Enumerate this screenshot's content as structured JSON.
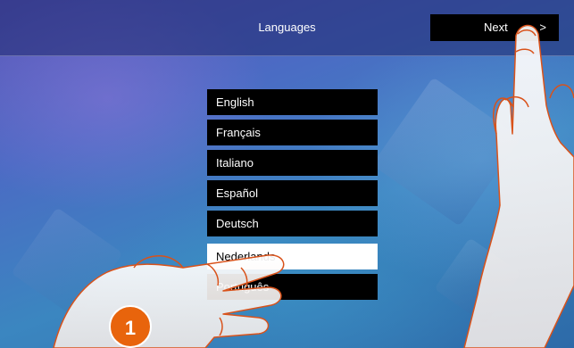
{
  "header": {
    "title": "Languages",
    "next_label": "Next",
    "next_arrow": ">"
  },
  "languages": [
    {
      "label": "English",
      "selected": false
    },
    {
      "label": "Français",
      "selected": false
    },
    {
      "label": "Italiano",
      "selected": false
    },
    {
      "label": "Español",
      "selected": false
    },
    {
      "label": "Deutsch",
      "selected": false
    },
    {
      "label": "Nederlands",
      "selected": true
    },
    {
      "label": "Português",
      "selected": false
    }
  ],
  "annotation": {
    "step_number": "1"
  },
  "colors": {
    "accent": "#e8640c",
    "button_bg": "#000000",
    "selected_bg": "#ffffff"
  }
}
